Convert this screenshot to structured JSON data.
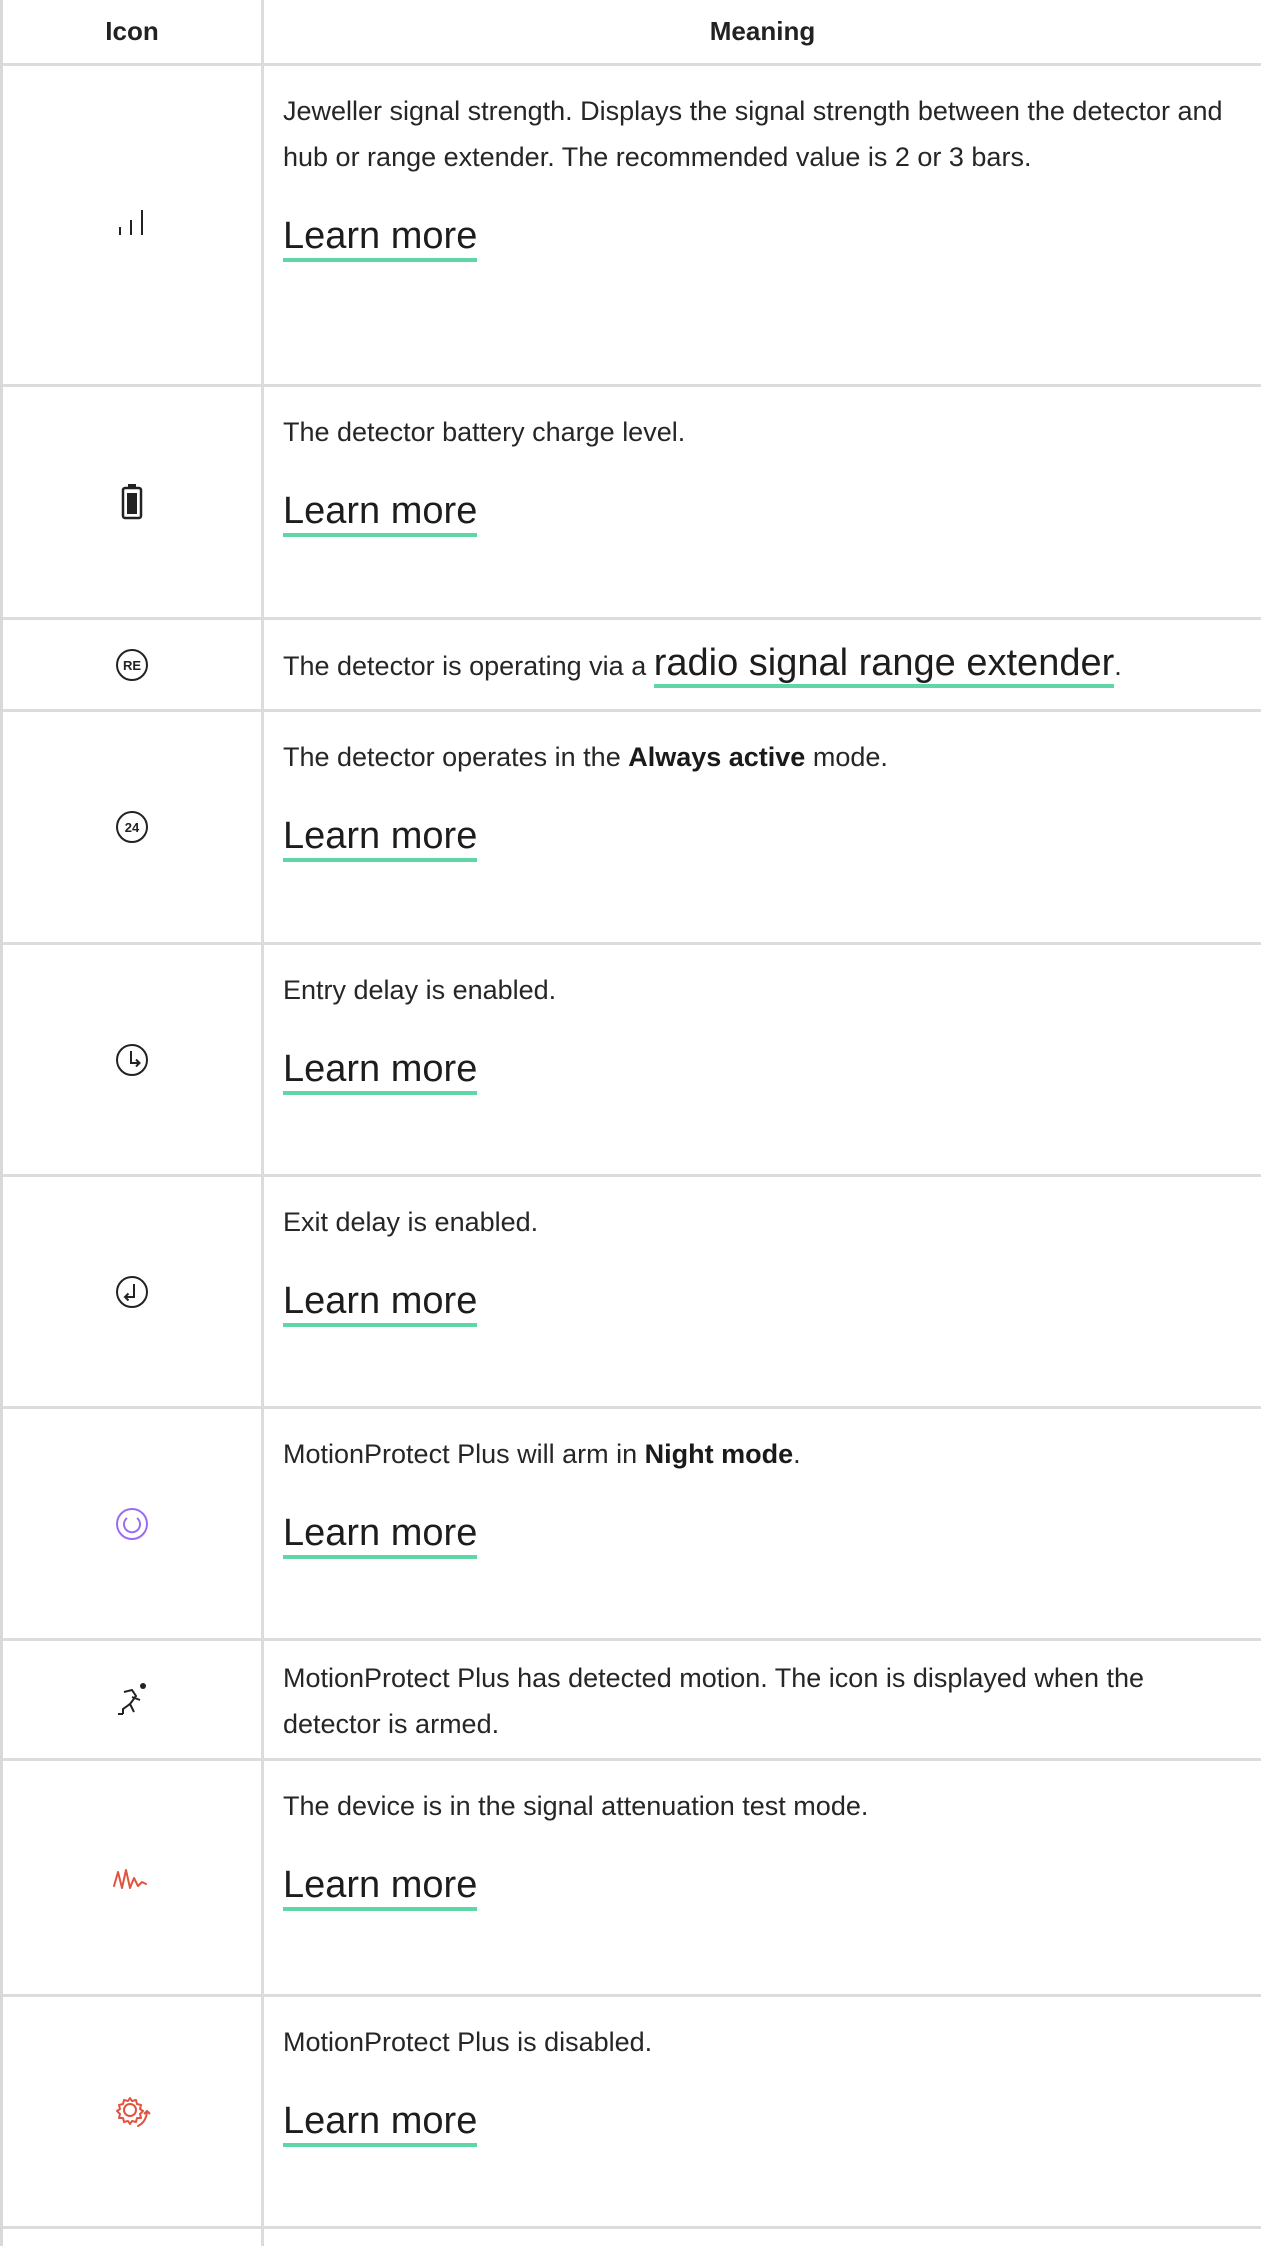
{
  "header": {
    "icon_col": "Icon",
    "meaning_col": "Meaning"
  },
  "rows": [
    {
      "icon": "signal-strength-icon",
      "text": "Jeweller signal strength. Displays the signal strength between the detector and hub or range extender. The recommended value is 2 or 3 bars.",
      "link": "Learn more"
    },
    {
      "icon": "battery-icon",
      "text": "The detector battery charge level.",
      "link": "Learn more"
    },
    {
      "icon": "range-extender-icon",
      "icon_text": "RE",
      "text_before": "The detector is operating via a ",
      "link": "radio signal range extender",
      "text_after": "."
    },
    {
      "icon": "always-active-icon",
      "icon_text": "24",
      "text_before": "The detector operates in the ",
      "bold": "Always active",
      "text_after": " mode.",
      "link": "Learn more"
    },
    {
      "icon": "entry-delay-icon",
      "text": "Entry delay is enabled.",
      "link": "Learn more"
    },
    {
      "icon": "exit-delay-icon",
      "text": "Exit delay is enabled.",
      "link": "Learn more"
    },
    {
      "icon": "night-mode-icon",
      "text_before": "MotionProtect Plus will arm in ",
      "bold": "Night mode",
      "text_after": ".",
      "link": "Learn more"
    },
    {
      "icon": "motion-detected-icon",
      "text": "MotionProtect Plus has detected motion. The icon is displayed when the detector is armed."
    },
    {
      "icon": "attenuation-test-icon",
      "text": "The device is in the signal attenuation test mode.",
      "link": "Learn more"
    },
    {
      "icon": "device-disabled-icon",
      "text": "MotionProtect Plus is disabled.",
      "link": "Learn more"
    }
  ],
  "colors": {
    "link_underline": "#5fd6a6",
    "night_mode_icon": "#9b6cf2",
    "attenuation_icon": "#e2533f",
    "disabled_icon": "#e2533f",
    "border": "#dcdcdc"
  }
}
